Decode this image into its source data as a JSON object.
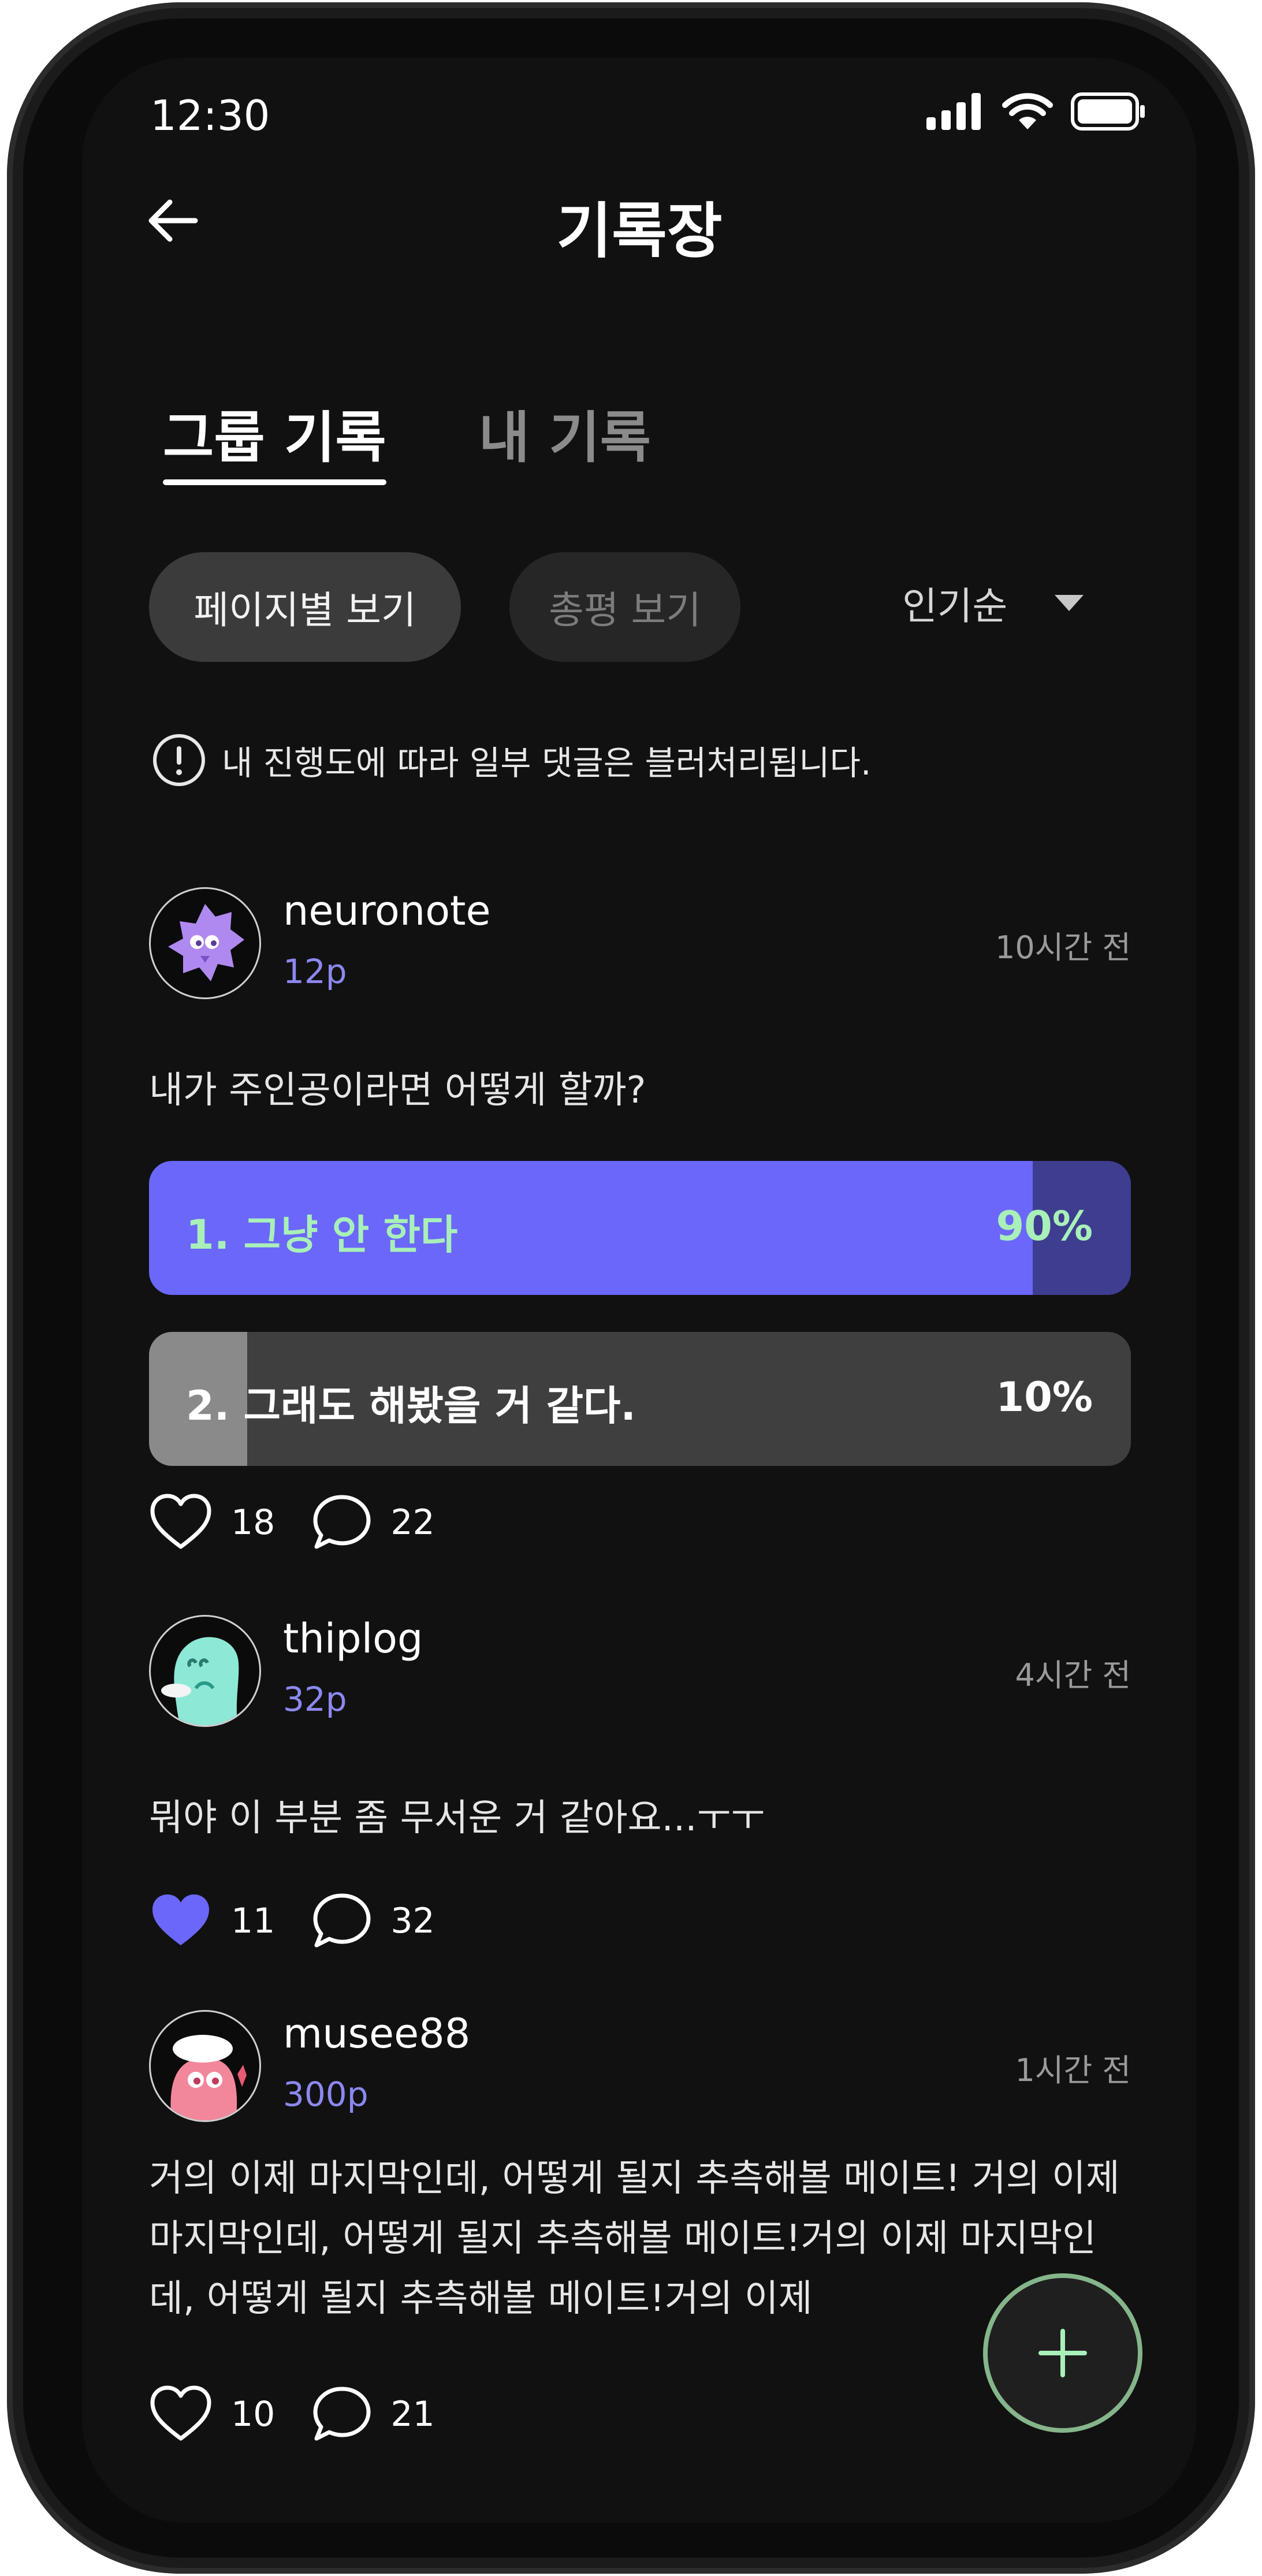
{
  "status_bar": {
    "time": "12:30"
  },
  "header": {
    "title": "기록장"
  },
  "tabs": [
    {
      "label": "그룹 기록"
    },
    {
      "label": "내 기록"
    }
  ],
  "filters": {
    "page_view": "페이지별 보기",
    "review_view": "총평 보기",
    "sort": "인기순"
  },
  "notice": "내 진행도에 따라 일부 댓글은 블러처리됩니다.",
  "posts": [
    {
      "user": "neuronote",
      "points": "12p",
      "time": "10시간 전",
      "text": "내가 주인공이라면 어떻게 할까?",
      "poll": [
        {
          "label": "1. 그냥 안 한다",
          "percent": "90%",
          "fraction": 0.9
        },
        {
          "label": "2. 그래도 해봤을 거 같다.",
          "percent": "10%",
          "fraction": 0.1
        }
      ],
      "likes": "18",
      "comments": "22",
      "liked": false
    },
    {
      "user": "thiplog",
      "points": "32p",
      "time": "4시간 전",
      "text": "뭐야 이 부분 좀 무서운 거 같아요...ㅜㅜ",
      "likes": "11",
      "comments": "32",
      "liked": true
    },
    {
      "user": "musee88",
      "points": "300p",
      "time": "1시간 전",
      "text": "거의 이제 마지막인데, 어떻게 될지 추측해볼 메이트! 거의 이제 마지막인데, 어떻게 될지 추측해볼 메이트!거의 이제 마지막인데, 어떻게 될지 추측해볼 메이트!거의 이제",
      "likes": "10",
      "comments": "21",
      "liked": false
    }
  ],
  "colors": {
    "accent": "#6a67fa",
    "poll_win_text": "#a8f0b8",
    "points": "#8c88f0",
    "fab_ring": "#85b58b"
  }
}
